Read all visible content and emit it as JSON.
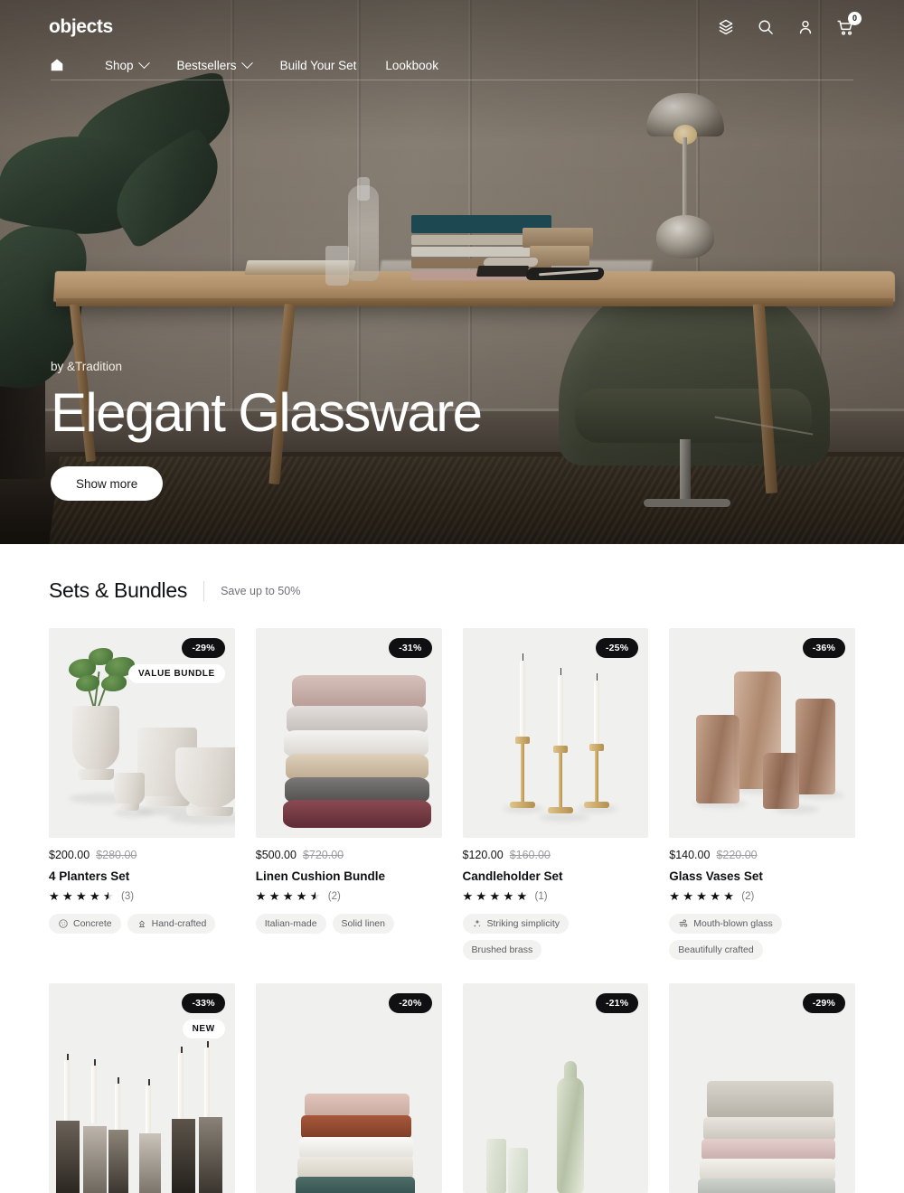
{
  "header": {
    "brand": "objects",
    "icons": [
      {
        "name": "package-icon",
        "label": "Orders"
      },
      {
        "name": "search-icon",
        "label": "Search"
      },
      {
        "name": "account-icon",
        "label": "Account"
      },
      {
        "name": "cart-icon",
        "label": "Cart"
      }
    ],
    "cart_count": "0",
    "nav": [
      {
        "label": "Shop",
        "has_dropdown": true
      },
      {
        "label": "Bestsellers",
        "has_dropdown": true
      },
      {
        "label": "Build Your Set",
        "has_dropdown": false
      },
      {
        "label": "Lookbook",
        "has_dropdown": false
      }
    ]
  },
  "hero": {
    "eyebrow": "by &Tradition",
    "title": "Elegant Glassware",
    "button": "Show more"
  },
  "section": {
    "title": "Sets & Bundles",
    "subtitle": "Save up to 50%"
  },
  "products": [
    {
      "discount": "-29%",
      "tag": "VALUE BUNDLE",
      "price": "$200.00",
      "compare_at": "$280.00",
      "title": "4 Planters Set",
      "stars": 4.5,
      "reviews": "(3)",
      "chips": [
        {
          "label": "Concrete",
          "icon": "concrete-icon"
        },
        {
          "label": "Hand-crafted",
          "icon": "handcraft-icon"
        }
      ]
    },
    {
      "discount": "-31%",
      "tag": "",
      "price": "$500.00",
      "compare_at": "$720.00",
      "title": "Linen Cushion Bundle",
      "stars": 4.5,
      "reviews": "(2)",
      "chips": [
        {
          "label": "Italian-made",
          "icon": ""
        },
        {
          "label": "Solid linen",
          "icon": ""
        }
      ]
    },
    {
      "discount": "-25%",
      "tag": "",
      "price": "$120.00",
      "compare_at": "$160.00",
      "title": "Candleholder Set",
      "stars": 5,
      "reviews": "(1)",
      "chips": [
        {
          "label": "Striking simplicity",
          "icon": "sparkle-icon"
        },
        {
          "label": "Brushed brass",
          "icon": ""
        }
      ]
    },
    {
      "discount": "-36%",
      "tag": "",
      "price": "$140.00",
      "compare_at": "$220.00",
      "title": "Glass Vases Set",
      "stars": 5,
      "reviews": "(2)",
      "chips": [
        {
          "label": "Mouth-blown glass",
          "icon": "blow-icon"
        },
        {
          "label": "Beautifully crafted",
          "icon": ""
        }
      ]
    }
  ],
  "products_row2": [
    {
      "discount": "-33%",
      "tag": "NEW"
    },
    {
      "discount": "-20%",
      "tag": ""
    },
    {
      "discount": "-21%",
      "tag": ""
    },
    {
      "discount": "-29%",
      "tag": ""
    }
  ],
  "colors": {
    "badge_bg": "#101012",
    "badge_fg": "#ffffff",
    "chip_bg": "#f2f2f0",
    "media_bg": "#f0f0ee",
    "text": "#0f1012",
    "muted": "#7b7c80"
  }
}
